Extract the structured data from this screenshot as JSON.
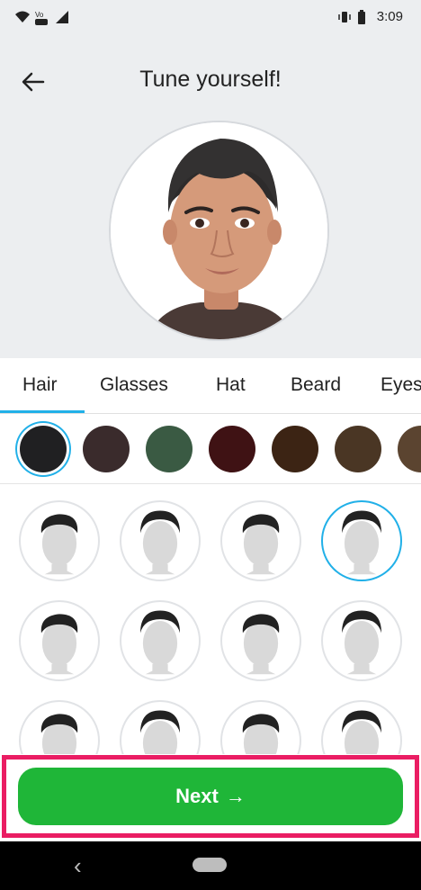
{
  "status": {
    "time": "3:09"
  },
  "header": {
    "title": "Tune yourself!"
  },
  "tabs": [
    {
      "label": "Hair",
      "active": true
    },
    {
      "label": "Glasses"
    },
    {
      "label": "Hat"
    },
    {
      "label": "Beard"
    },
    {
      "label": "Eyes"
    }
  ],
  "hair_colors": [
    "#202022",
    "#3a2b2c",
    "#3a5a43",
    "#3f1214",
    "#3c2414",
    "#4a3624",
    "#5b4430"
  ],
  "hair_styles": {
    "rows": 3,
    "columns": 4,
    "selected_index": 3
  },
  "actions": {
    "next_label": "Next",
    "next_arrow": "→"
  },
  "colors": {
    "accent": "#21b0e8",
    "primary_button": "#1fb638",
    "highlight_frame": "#ea1d63",
    "header_bg": "#eceef0"
  }
}
